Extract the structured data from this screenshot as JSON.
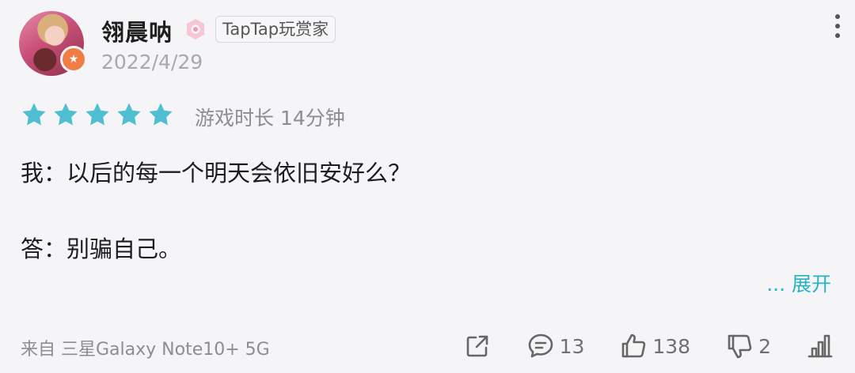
{
  "user": {
    "name": "翎晨呐",
    "tag": "TapTap玩赏家",
    "date": "2022/4/29"
  },
  "rating": {
    "stars": 5,
    "playtime": "游戏时长 14分钟",
    "star_color": "#4dbfd0"
  },
  "review": {
    "line1": "我：以后的每一个明天会依旧安好么？",
    "line2": "答：别骗自己。",
    "expand_label": "... 展开"
  },
  "footer": {
    "device": "来自 三星Galaxy Note10+ 5G",
    "comments": "13",
    "likes": "138",
    "dislikes": "2"
  },
  "colors": {
    "accent": "#27b2c4",
    "badge": "#f07d46"
  }
}
